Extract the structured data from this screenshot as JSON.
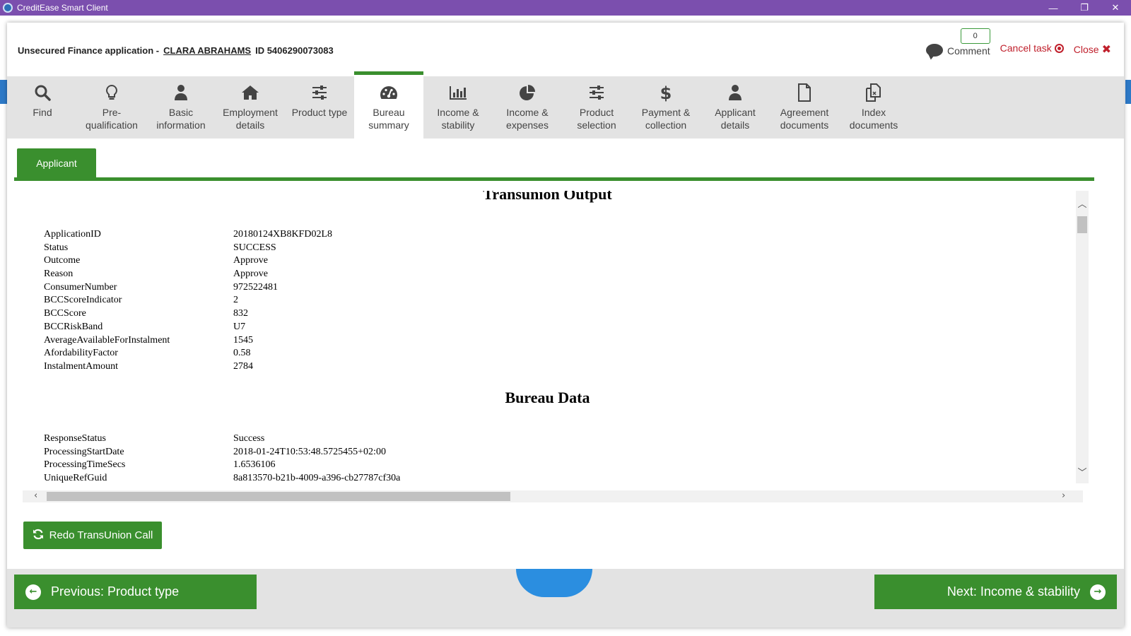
{
  "window": {
    "title": "CreditEase Smart Client",
    "minimize": "—",
    "restore": "❐",
    "close": "✕"
  },
  "header": {
    "title_prefix": "Unsecured Finance application -",
    "client_name": "CLARA ABRAHAMS",
    "client_id": "ID 5406290073083",
    "comment_count": "0",
    "comment_label": "Comment",
    "cancel_label": "Cancel task",
    "close_label": "Close"
  },
  "steps": [
    {
      "line1": "Find",
      "line2": "",
      "icon": "search-icon"
    },
    {
      "line1": "Pre-",
      "line2": "qualification",
      "icon": "lightbulb-icon"
    },
    {
      "line1": "Basic",
      "line2": "information",
      "icon": "user-icon"
    },
    {
      "line1": "Employment",
      "line2": "details",
      "icon": "home-icon"
    },
    {
      "line1": "Product type",
      "line2": "",
      "icon": "sliders-icon"
    },
    {
      "line1": "Bureau",
      "line2": "summary",
      "icon": "dashboard-icon",
      "active": true
    },
    {
      "line1": "Income &",
      "line2": "stability",
      "icon": "bar-chart-icon"
    },
    {
      "line1": "Income &",
      "line2": "expenses",
      "icon": "pie-chart-icon"
    },
    {
      "line1": "Product",
      "line2": "selection",
      "icon": "sliders-icon"
    },
    {
      "line1": "Payment &",
      "line2": "collection",
      "icon": "dollar-icon"
    },
    {
      "line1": "Applicant",
      "line2": "details",
      "icon": "user-icon"
    },
    {
      "line1": "Agreement",
      "line2": "documents",
      "icon": "document-icon"
    },
    {
      "line1": "Index",
      "line2": "documents",
      "icon": "documents-icon"
    }
  ],
  "tabs": {
    "applicant": "Applicant"
  },
  "report": {
    "transunion_title": "Transunion Output",
    "transunion_rows": [
      {
        "key": "ApplicationID",
        "value": "20180124XB8KFD02L8"
      },
      {
        "key": "Status",
        "value": "SUCCESS"
      },
      {
        "key": "Outcome",
        "value": "Approve"
      },
      {
        "key": "Reason",
        "value": "Approve"
      },
      {
        "key": "ConsumerNumber",
        "value": "972522481"
      },
      {
        "key": "BCCScoreIndicator",
        "value": "2"
      },
      {
        "key": "BCCScore",
        "value": "832"
      },
      {
        "key": "BCCRiskBand",
        "value": "U7"
      },
      {
        "key": "AverageAvailableForInstalment",
        "value": "1545"
      },
      {
        "key": "AfordabilityFactor",
        "value": "0.58"
      },
      {
        "key": "InstalmentAmount",
        "value": "2784"
      }
    ],
    "bureau_title": "Bureau Data",
    "bureau_rows": [
      {
        "key": "ResponseStatus",
        "value": "Success"
      },
      {
        "key": "ProcessingStartDate",
        "value": "2018-01-24T10:53:48.5725455+02:00"
      },
      {
        "key": "ProcessingTimeSecs",
        "value": "1.6536106"
      },
      {
        "key": "UniqueRefGuid",
        "value": "8a813570-b21b-4009-a396-cb27787cf30a"
      }
    ]
  },
  "actions": {
    "redo_label": "Redo TransUnion Call",
    "prev_label": "Previous: Product type",
    "next_label": "Next: Income & stability"
  },
  "colors": {
    "titlebar": "#7b4fae",
    "accent_green": "#3a8f2e",
    "danger_red": "#c0202c",
    "steps_bg": "#e3e3e3"
  }
}
